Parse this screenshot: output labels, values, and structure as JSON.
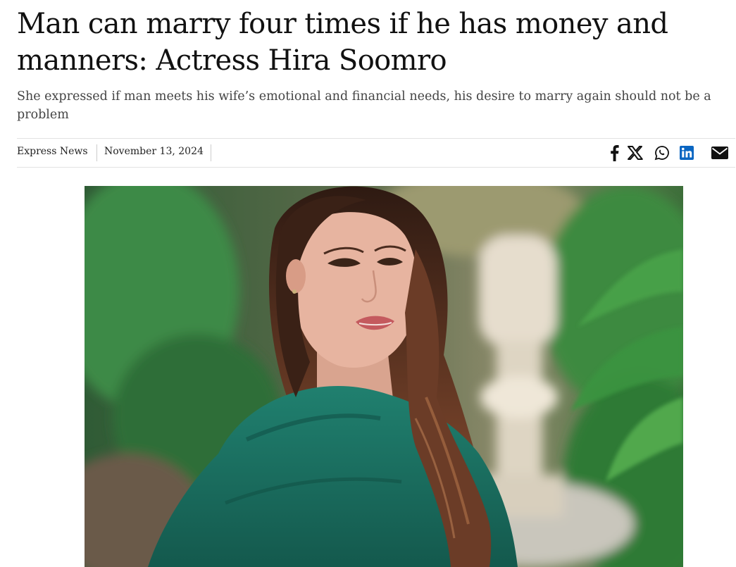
{
  "article": {
    "headline": "Man can marry four times if he has money and manners: Actress Hira Soomro",
    "subheadline": "She expressed if man meets his wife’s emotional and financial needs, his desire to marry again should not be a problem",
    "source": "Express News",
    "date": "November 13, 2024"
  },
  "share_icons": [
    {
      "name": "facebook-icon",
      "color": "#111111"
    },
    {
      "name": "x-icon",
      "color": "#111111"
    },
    {
      "name": "whatsapp-icon",
      "color": "#111111"
    },
    {
      "name": "linkedin-icon",
      "color": "#0a66c2"
    },
    {
      "name": "email-icon",
      "color": "#111111"
    }
  ],
  "hero_image": {
    "subject": "photo-of-woman-in-green-shawl",
    "colors": {
      "shawl": "#1f7a6c",
      "hair": "#5a3424",
      "skin": "#e7b4a0",
      "foliage": "#3f8a4a",
      "pillar": "#e8e0d2"
    }
  }
}
